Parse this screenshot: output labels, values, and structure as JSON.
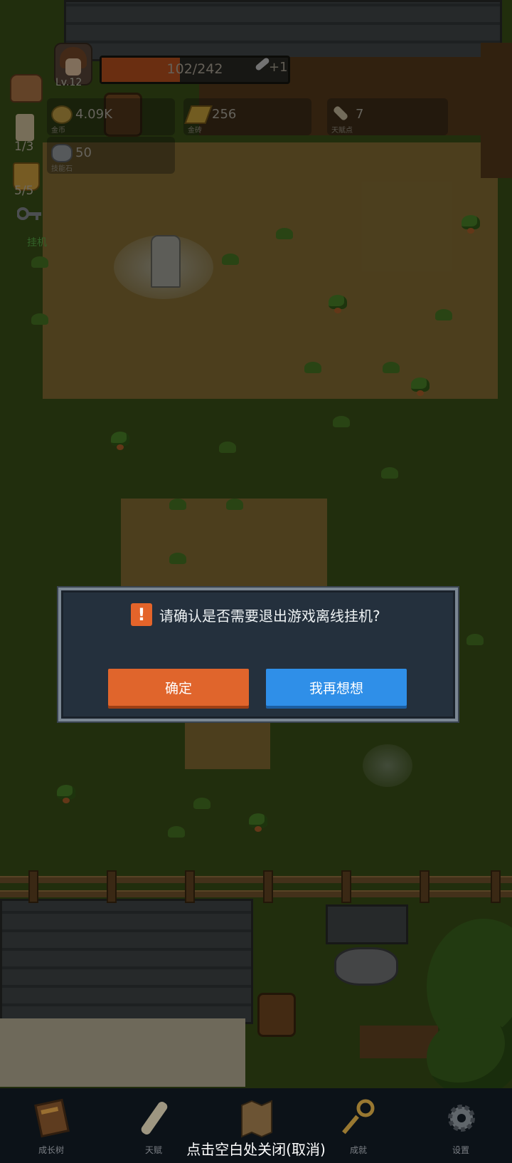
{
  "hud": {
    "level": "Lv.12",
    "xp_text": "102/242",
    "xp_progress": 0.42,
    "xp_bonus": "+1",
    "resources": [
      {
        "icon": "gold-coin-icon",
        "value": "4.09K",
        "label": "金币"
      },
      {
        "icon": "gold-bar-icon",
        "value": "256",
        "label": "金砖"
      },
      {
        "icon": "talent-scroll-icon",
        "value": "7",
        "label": "天赋点"
      },
      {
        "icon": "skill-stone-icon",
        "value": "50",
        "label": "技能石"
      }
    ],
    "side": {
      "candle_count": "1/3",
      "cup_count": "5/5",
      "idle_label": "挂机"
    }
  },
  "dialog": {
    "icon": "exclamation-icon",
    "icon_glyph": "!",
    "message": "请确认是否需要退出游戏离线挂机?",
    "confirm_label": "确定",
    "cancel_label": "我再想想"
  },
  "bottom_nav": {
    "items": [
      {
        "icon": "book-icon",
        "label": "成长树"
      },
      {
        "icon": "scroll-icon",
        "label": "天赋"
      },
      {
        "icon": "map-icon",
        "label": ""
      },
      {
        "icon": "key-icon",
        "label": "成就"
      },
      {
        "icon": "gear-icon",
        "label": "设置"
      }
    ],
    "close_hint": "点击空白处关闭(取消)"
  },
  "colors": {
    "confirm": "#e0652c",
    "cancel": "#2f8fe8",
    "dialog_bg": "#24303d",
    "xp_fill": "#c2551f"
  }
}
